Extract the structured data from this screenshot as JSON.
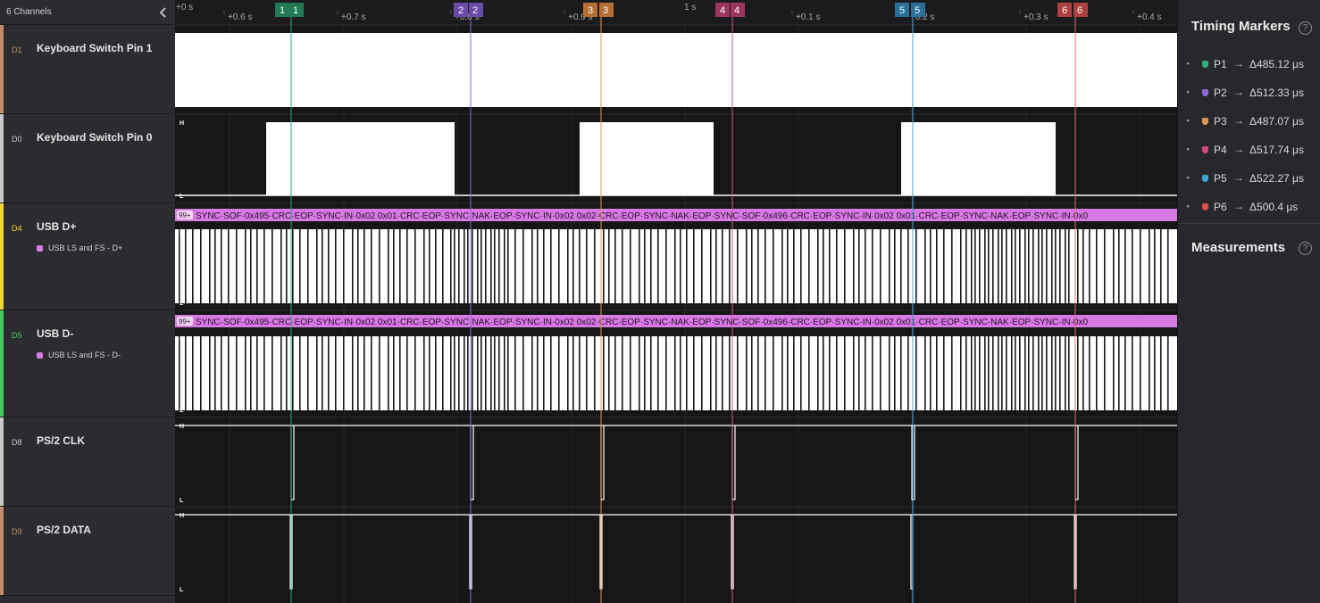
{
  "left_panel": {
    "channels_label": "6 Channels",
    "collapse_icon": "chevron-left-icon"
  },
  "channels": [
    {
      "id": "D1",
      "name": "Keyboard Switch Pin 1",
      "color": "#c4896a",
      "id_color": "#c4896a",
      "analyzer": null
    },
    {
      "id": "D0",
      "name": "Keyboard Switch Pin 0",
      "color": "#c9c9c9",
      "id_color": "#c9c9c9",
      "analyzer": null
    },
    {
      "id": "D4",
      "name": "USB D+",
      "color": "#f2d632",
      "id_color": "#f2d632",
      "analyzer": "USB LS and FS - D+",
      "analyzer_color": "#d77ae3"
    },
    {
      "id": "D5",
      "name": "USB D-",
      "color": "#43c85a",
      "id_color": "#43c85a",
      "analyzer": "USB LS and FS - D-",
      "analyzer_color": "#d77ae3"
    },
    {
      "id": "D8",
      "name": "PS/2 CLK",
      "color": "#c9c9c9",
      "id_color": "#c9c9c9",
      "analyzer": null
    },
    {
      "id": "D9",
      "name": "PS/2 DATA",
      "color": "#c4896a",
      "id_color": "#c4896a",
      "analyzer": null
    }
  ],
  "timeline": {
    "major_labels": [
      "+0 s",
      "1 s"
    ],
    "minor_labels": [
      "+0.6 s",
      "+0.7 s",
      "+0.8 s",
      "+0.9 s",
      "+0.1 s",
      "+0.2 s",
      "+0.3 s",
      "+0.4 s"
    ],
    "level_high": "H",
    "level_low": "L"
  },
  "protocol": {
    "badge": "99+",
    "d_plus_text": "SYNC·SOF·0x495·CRC·EOP·SYNC·IN·0x02 0x01·CRC·EOP·SYNC·NAK·EOP·SYNC·IN·0x02 0x02·CRC·EOP·SYNC·NAK·EOP·SYNC·SOF·0x496·CRC·EOP·SYNC·IN·0x02 0x01·CRC·EOP·SYNC·NAK·EOP·SYNC·IN·0x0",
    "d_minus_text": "SYNC·SOF·0x495·CRC·EOP·SYNC·IN·0x02 0x01·CRC·EOP·SYNC·NAK·EOP·SYNC·IN·0x02 0x02·CRC·EOP·SYNC·NAK·EOP·SYNC·SOF·0x496·CRC·EOP·SYNC·IN·0x02 0x01·CRC·EOP·SYNC·NAK·EOP·SYNC·IN·0x0"
  },
  "markers": [
    {
      "name": "P1",
      "flag": "1",
      "color": "#1f7a55",
      "line": "#27a87a",
      "delta": "Δ485.12 μs",
      "shield": "#2bb27f"
    },
    {
      "name": "P2",
      "flag": "2",
      "color": "#6b4aa8",
      "line": "#8a66d6",
      "delta": "Δ512.33 μs",
      "shield": "#8d66de"
    },
    {
      "name": "P3",
      "flag": "3",
      "color": "#b56f35",
      "line": "#e39a5c",
      "delta": "Δ487.07 μs",
      "shield": "#e8944a"
    },
    {
      "name": "P4",
      "flag": "4",
      "color": "#9c3560",
      "line": "#c95b86",
      "delta": "Δ517.74 μs",
      "shield": "#d6457a"
    },
    {
      "name": "P5",
      "flag": "5",
      "color": "#2a6f98",
      "line": "#4aa8d8",
      "delta": "Δ522.27 μs",
      "shield": "#3aa6e0"
    },
    {
      "name": "P6",
      "flag": "6",
      "color": "#b03f3f",
      "line": "#e07070",
      "delta": "Δ500.4 μs",
      "shield": "#e24c4c"
    }
  ],
  "right_panel": {
    "timing_markers_title": "Timing Markers",
    "measurements_title": "Measurements",
    "help_glyph": "?",
    "arrow_glyph": "→",
    "expand_glyph": "▸"
  }
}
